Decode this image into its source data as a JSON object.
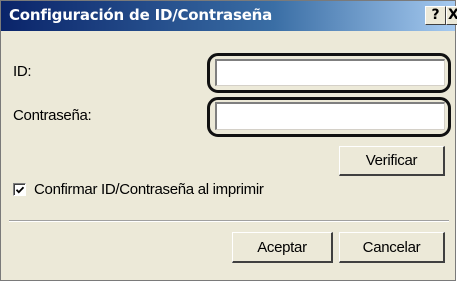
{
  "window": {
    "title": "Configuración de ID/Contraseña",
    "help_button": "?",
    "close_button": "X"
  },
  "form": {
    "id_label": "ID:",
    "id_value": "",
    "password_label": "Contraseña:",
    "password_value": "",
    "verify_button": "Verificar",
    "confirm_checkbox": {
      "label": "Confirmar ID/Contraseña al imprimir",
      "checked": true
    }
  },
  "footer": {
    "ok_button": "Aceptar",
    "cancel_button": "Cancelar"
  }
}
